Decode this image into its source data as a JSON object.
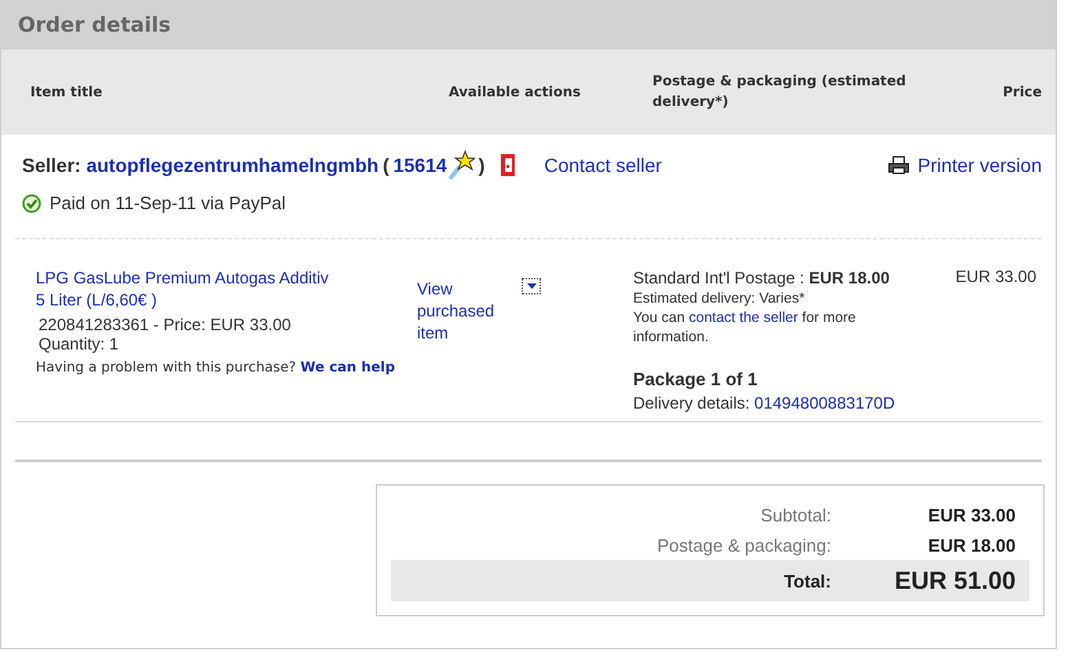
{
  "title": "Order details",
  "columns": [
    {
      "label": "Item title"
    },
    {
      "label": "Available actions"
    },
    {
      "label": "Postage & packaging (estimated delivery*)"
    },
    {
      "label": "Price"
    }
  ],
  "seller": {
    "label": "Seller:",
    "name": "autopflegezentrumhamelngmbh",
    "open": "(",
    "score": "15614",
    "close": ")",
    "contact": "Contact seller"
  },
  "printer": "Printer version",
  "payment": {
    "paid": true,
    "text": "Paid on 11-Sep-11 via PayPal"
  },
  "items": [
    {
      "title": "LPG GasLube Premium Autogas Additiv 5 Liter (L/6,60€ )",
      "id_price": "220841283361 - Price: EUR 33.00",
      "quantity": "Quantity: 1",
      "problem": "Having a problem with this purchase?",
      "help": "We can help",
      "action": "View purchased item",
      "postage_service": "Standard Int'l Postage : ",
      "postage_amount": "EUR 18.00",
      "estimated": "Estimated delivery: Varies*",
      "contact_pre": "You can ",
      "contact_link": "contact the seller",
      "contact_post": " for more information.",
      "package": "Package 1 of 1",
      "delivery_label": "Delivery details: ",
      "delivery_number": "01494800883170D",
      "price": "EUR 33.00"
    }
  ],
  "totals": [
    {
      "kind": "normal",
      "label": "Subtotal:",
      "value": "EUR 33.00"
    },
    {
      "kind": "normal",
      "label": "Postage & packaging:",
      "value": "EUR 18.00"
    },
    {
      "kind": "total",
      "label": "Total:",
      "value": "EUR 51.00"
    }
  ]
}
